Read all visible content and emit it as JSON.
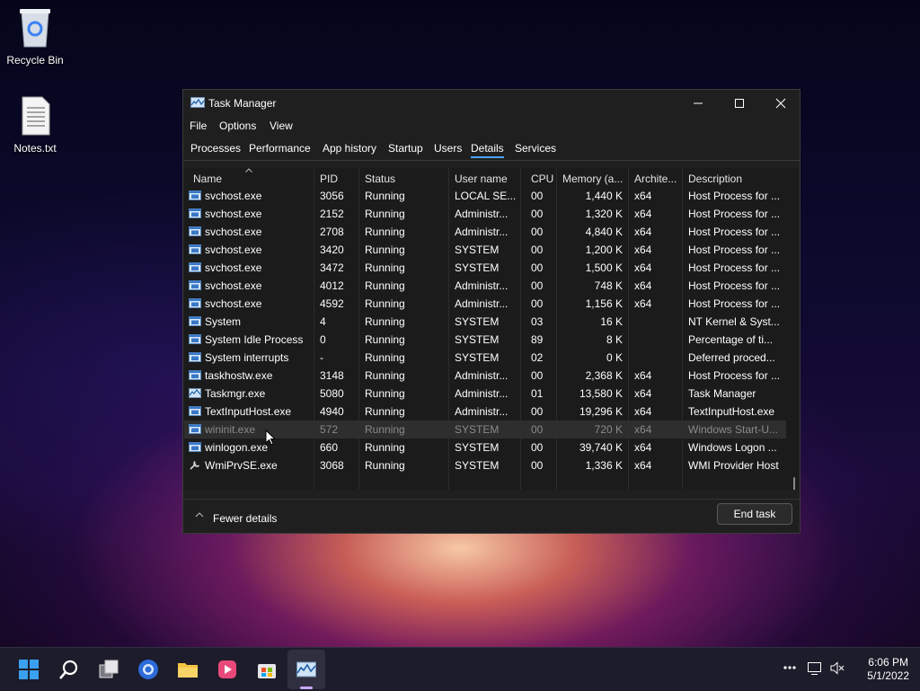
{
  "desktop": {
    "icons": [
      {
        "label": "Recycle Bin",
        "icon": "recycle-bin-icon"
      },
      {
        "label": "Notes.txt",
        "icon": "text-file-icon"
      }
    ]
  },
  "window": {
    "title": "Task Manager",
    "menu": [
      "File",
      "Options",
      "View"
    ],
    "tabs": [
      "Processes",
      "Performance",
      "App history",
      "Startup",
      "Users",
      "Details",
      "Services"
    ],
    "active_tab": "Details",
    "columns": [
      "Name",
      "PID",
      "Status",
      "User name",
      "CPU",
      "Memory (a...",
      "Archite...",
      "Description"
    ],
    "sorted_column": "Name",
    "rows": [
      {
        "name": "svchost.exe",
        "pid": "3056",
        "status": "Running",
        "user": "LOCAL SE...",
        "cpu": "00",
        "mem": "1,440 K",
        "arch": "x64",
        "desc": "Host Process for ..."
      },
      {
        "name": "svchost.exe",
        "pid": "2152",
        "status": "Running",
        "user": "Administr...",
        "cpu": "00",
        "mem": "1,320 K",
        "arch": "x64",
        "desc": "Host Process for ..."
      },
      {
        "name": "svchost.exe",
        "pid": "2708",
        "status": "Running",
        "user": "Administr...",
        "cpu": "00",
        "mem": "4,840 K",
        "arch": "x64",
        "desc": "Host Process for ..."
      },
      {
        "name": "svchost.exe",
        "pid": "3420",
        "status": "Running",
        "user": "SYSTEM",
        "cpu": "00",
        "mem": "1,200 K",
        "arch": "x64",
        "desc": "Host Process for ..."
      },
      {
        "name": "svchost.exe",
        "pid": "3472",
        "status": "Running",
        "user": "SYSTEM",
        "cpu": "00",
        "mem": "1,500 K",
        "arch": "x64",
        "desc": "Host Process for ..."
      },
      {
        "name": "svchost.exe",
        "pid": "4012",
        "status": "Running",
        "user": "Administr...",
        "cpu": "00",
        "mem": "748 K",
        "arch": "x64",
        "desc": "Host Process for ..."
      },
      {
        "name": "svchost.exe",
        "pid": "4592",
        "status": "Running",
        "user": "Administr...",
        "cpu": "00",
        "mem": "1,156 K",
        "arch": "x64",
        "desc": "Host Process for ..."
      },
      {
        "name": "System",
        "pid": "4",
        "status": "Running",
        "user": "SYSTEM",
        "cpu": "03",
        "mem": "16 K",
        "arch": "",
        "desc": "NT Kernel & Syst..."
      },
      {
        "name": "System Idle Process",
        "pid": "0",
        "status": "Running",
        "user": "SYSTEM",
        "cpu": "89",
        "mem": "8 K",
        "arch": "",
        "desc": "Percentage of ti..."
      },
      {
        "name": "System interrupts",
        "pid": "-",
        "status": "Running",
        "user": "SYSTEM",
        "cpu": "02",
        "mem": "0 K",
        "arch": "",
        "desc": "Deferred proced..."
      },
      {
        "name": "taskhostw.exe",
        "pid": "3148",
        "status": "Running",
        "user": "Administr...",
        "cpu": "00",
        "mem": "2,368 K",
        "arch": "x64",
        "desc": "Host Process for ..."
      },
      {
        "name": "Taskmgr.exe",
        "pid": "5080",
        "status": "Running",
        "user": "Administr...",
        "cpu": "01",
        "mem": "13,580 K",
        "arch": "x64",
        "desc": "Task Manager"
      },
      {
        "name": "TextInputHost.exe",
        "pid": "4940",
        "status": "Running",
        "user": "Administr...",
        "cpu": "00",
        "mem": "19,296 K",
        "arch": "x64",
        "desc": "TextInputHost.exe"
      },
      {
        "name": "wininit.exe",
        "pid": "572",
        "status": "Running",
        "user": "SYSTEM",
        "cpu": "00",
        "mem": "720 K",
        "arch": "x64",
        "desc": "Windows Start-U..."
      },
      {
        "name": "winlogon.exe",
        "pid": "660",
        "status": "Running",
        "user": "SYSTEM",
        "cpu": "00",
        "mem": "39,740 K",
        "arch": "x64",
        "desc": "Windows Logon ..."
      },
      {
        "name": "WmiPrvSE.exe",
        "pid": "3068",
        "status": "Running",
        "user": "SYSTEM",
        "cpu": "00",
        "mem": "1,336 K",
        "arch": "x64",
        "desc": "WMI Provider Host"
      }
    ],
    "selected_row": "wininit.exe",
    "footer": {
      "fewer_details": "Fewer details",
      "end_task": "End task"
    }
  },
  "taskbar": {
    "apps": [
      "start-icon",
      "search-icon",
      "task-view-icon",
      "browser-icon",
      "file-explorer-icon",
      "media-player-icon",
      "store-icon",
      "task-manager-icon"
    ],
    "time": "6:06 PM",
    "date": "5/1/2022"
  },
  "colors": {
    "accent": "#4aa3ff",
    "window_bg": "#1f1f1f",
    "taskbar_bg": "#1c1c2a"
  }
}
